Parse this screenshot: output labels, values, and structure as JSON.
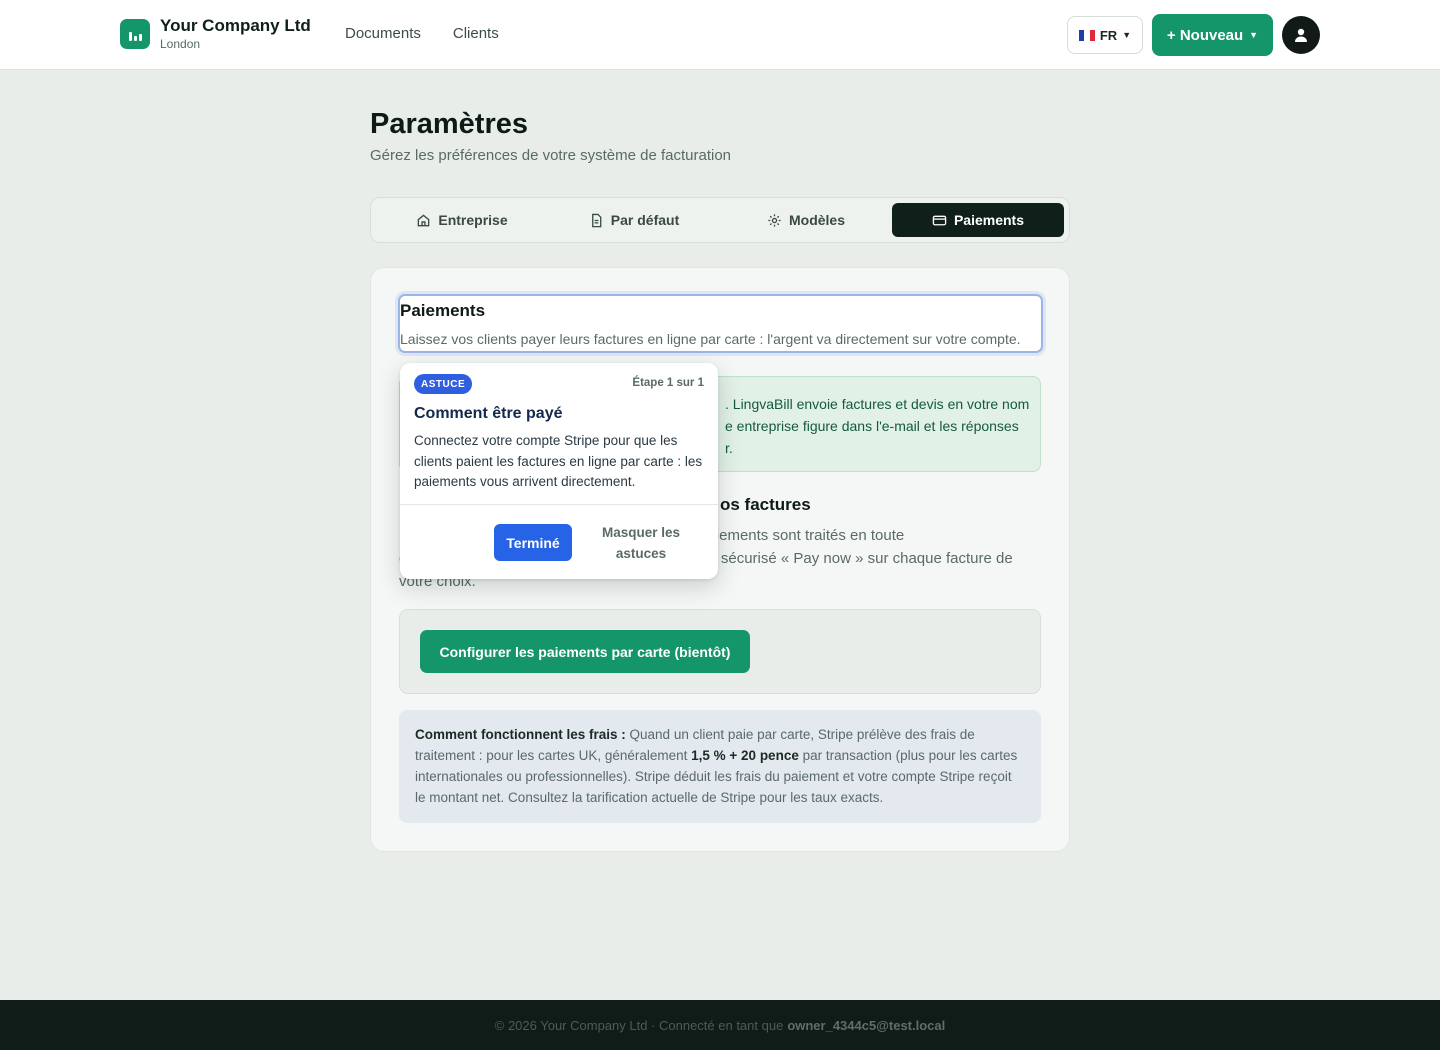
{
  "header": {
    "company_name": "Your Company Ltd",
    "company_city": "London",
    "nav": [
      "Documents",
      "Clients"
    ],
    "language": "FR",
    "new_button": "+ Nouveau"
  },
  "page": {
    "title": "Paramètres",
    "subtitle": "Gérez les préférences de votre système de facturation"
  },
  "tabs": [
    {
      "label": "Entreprise",
      "icon": "home-icon",
      "active": false
    },
    {
      "label": "Par défaut",
      "icon": "document-icon",
      "active": false
    },
    {
      "label": "Modèles",
      "icon": "gear-icon",
      "active": false
    },
    {
      "label": "Paiements",
      "icon": "card-icon",
      "active": true
    }
  ],
  "payments": {
    "title": "Paiements",
    "description": "Laissez vos clients payer leurs factures en ligne par carte : l'argent va directement sur votre compte.",
    "notice": ". LingvaBill envoie factures et devis en votre nom e entreprise figure dans l'e-mail et les réponses r.",
    "section_title": "os factures",
    "paragraph": "                                                   ar carte. Les paiements sont traités en toute                                                   otre propre compte Stripe. Vous obtenez un lien sécurisé « Pay now » sur chaque facture de votre choix.",
    "cta": "Configurer les paiements par carte (bientôt)",
    "fees_label": "Comment fonctionnent les frais :",
    "fees_text_1": " Quand un client paie par carte, Stripe prélève des frais de traitement : pour les cartes UK, généralement ",
    "fees_highlight": "1,5 % + 20 pence",
    "fees_text_2": " par transaction (plus pour les cartes internationales ou professionnelles). Stripe déduit les frais du paiement et votre compte Stripe reçoit le montant net. Consultez la tarification actuelle de Stripe pour les taux exacts."
  },
  "tip": {
    "badge": "ASTUCE",
    "step": "Étape 1 sur 1",
    "title": "Comment être payé",
    "body": "Connectez votre compte Stripe pour que les clients paient les factures en ligne par carte : les paiements vous arrivent directement.",
    "done": "Terminé",
    "hide": "Masquer les astuces"
  },
  "footer": {
    "text": "© 2026 Your Company Ltd · Connecté en tant que",
    "email": "owner_4344c5@test.local"
  },
  "colors": {
    "brand": "#15956a",
    "dark": "#0f1f1a",
    "tip_blue": "#2663e6"
  }
}
